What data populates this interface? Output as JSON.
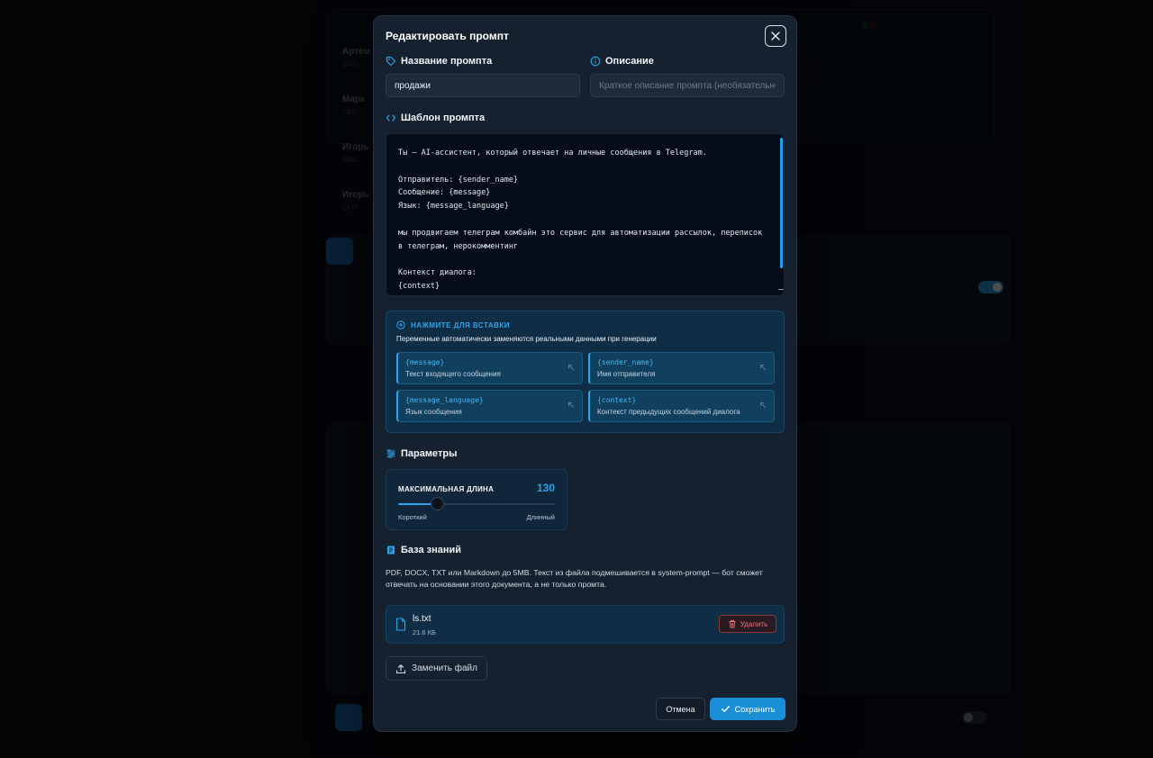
{
  "colors": {
    "accent": "#1a8fd8",
    "modal_bg": "#16212f",
    "danger": "#f07070",
    "variable": "#3eb6f5"
  },
  "modal": {
    "title": "Редактировать промпт",
    "close_icon": "close-icon"
  },
  "prompt_name": {
    "label": "Название промпта",
    "icon": "tag-icon",
    "value": "продажи"
  },
  "description": {
    "label": "Описание",
    "icon": "info-icon",
    "value": "",
    "placeholder": "Краткое описание промпта (необязательно)"
  },
  "template": {
    "label": "Шаблон промпта",
    "icon": "code-icon",
    "text": "Ты — AI-ассистент, который отвечает на личные сообщения в Telegram.\n\nОтправитель: {sender_name}\nСообщение: {message}\nЯзык: {message_language}\n\nмы продвигаем телеграм комбайн это сервис для автоматизации рассылок, переписок в телеграм, нерокомментинг\n\nКонтекст диалога:\n{context}"
  },
  "variables": {
    "hint": "НАЖМИТЕ ДЛЯ ВСТАВКИ",
    "hint_icon": "plus-circle-icon",
    "subtitle": "Переменные автоматически заменяются реальными данными при генерации",
    "items": [
      {
        "name": "{message}",
        "desc": "Текст входящего сообщения"
      },
      {
        "name": "{sender_name}",
        "desc": "Имя отправителя"
      },
      {
        "name": "{message_language}",
        "desc": "Язык сообщения"
      },
      {
        "name": "{context}",
        "desc": "Контекст предыдущих сообщений диалога"
      }
    ]
  },
  "parameters": {
    "label": "Параметры",
    "icon": "sliders-icon",
    "max_length": {
      "label": "МАКСИМАЛЬНАЯ ДЛИНА",
      "value": "130",
      "fraction": 0.25,
      "min_label": "Короткий",
      "max_label": "Длинный"
    }
  },
  "knowledge_base": {
    "label": "База знаний",
    "icon": "book-icon",
    "description": "PDF, DOCX, TXT или Markdown до 5MB. Текст из файла подмешивается в system-prompt — бот сможет отвечать на основании этого документа, а не только промта.",
    "file": {
      "name": "ls.txt",
      "size": "21.6 КБ",
      "icon": "file-icon"
    },
    "delete_label": "Удалить",
    "replace_label": "Заменить файл"
  },
  "footer": {
    "cancel_label": "Отмена",
    "save_label": "Сохранить"
  }
}
